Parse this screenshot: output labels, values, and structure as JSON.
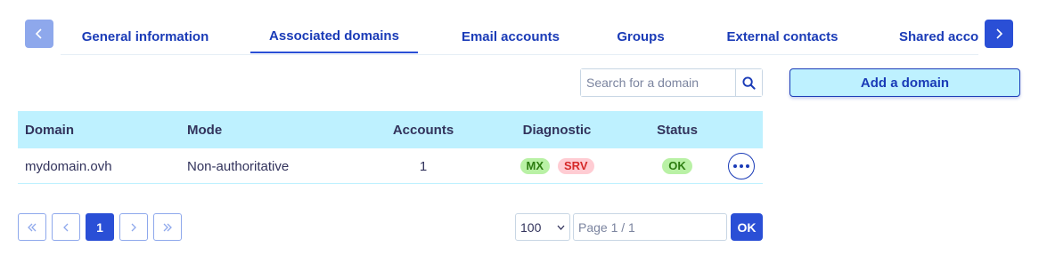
{
  "tabs": {
    "items": [
      {
        "label": "General information"
      },
      {
        "label": "Associated domains"
      },
      {
        "label": "Email accounts"
      },
      {
        "label": "Groups"
      },
      {
        "label": "External contacts"
      },
      {
        "label": "Shared accou"
      }
    ],
    "active_index": 1
  },
  "toolbar": {
    "search_placeholder": "Search for a domain",
    "add_button_label": "Add a domain"
  },
  "table": {
    "headers": {
      "domain": "Domain",
      "mode": "Mode",
      "accounts": "Accounts",
      "diagnostic": "Diagnostic",
      "status": "Status"
    },
    "rows": [
      {
        "domain": "mydomain.ovh",
        "mode": "Non-authoritative",
        "accounts": "1",
        "diagnostic": [
          {
            "label": "MX",
            "state": "ok"
          },
          {
            "label": "SRV",
            "state": "error"
          }
        ],
        "status": "OK"
      }
    ]
  },
  "pagination": {
    "current_page": "1",
    "per_page": "100",
    "page_field_placeholder": "Page 1 / 1",
    "ok_label": "OK"
  },
  "colors": {
    "primary": "#2a4fd6",
    "header_bg": "#bef1ff",
    "ok_badge": "#b9f1a5",
    "error_badge": "#ffccd3"
  }
}
